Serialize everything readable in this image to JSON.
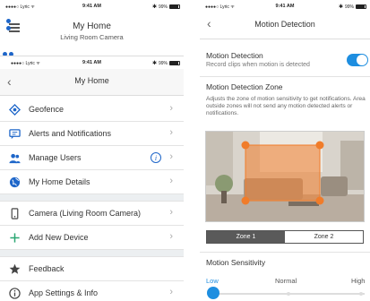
{
  "status_bar": {
    "carrier": "●●●●○ Lyric ᯤ",
    "time": "9:41 AM",
    "bluetooth": "✱",
    "battery": "99%"
  },
  "back_screen": {
    "title": "My Home",
    "subtitle": "Living Room Camera"
  },
  "front_screen": {
    "nav_title": "My Home",
    "items": [
      {
        "label": "Geofence",
        "icon": "geofence-icon"
      },
      {
        "label": "Alerts and Notifications",
        "icon": "chat-icon"
      },
      {
        "label": "Manage Users",
        "icon": "users-icon",
        "badge": "i"
      },
      {
        "label": "My Home Details",
        "icon": "globe-icon"
      },
      {
        "label": "Camera (Living Room Camera)",
        "icon": "phone-icon"
      },
      {
        "label": "Add New Device",
        "icon": "plus-icon"
      },
      {
        "label": "Feedback",
        "icon": "star-icon"
      },
      {
        "label": "App Settings & Info",
        "icon": "info-icon"
      }
    ]
  },
  "right_screen": {
    "status_battery": "99%",
    "nav_title": "Motion Detection",
    "motion_detection_title": "Motion Detection",
    "motion_detection_sub": "Record clips when motion is detected",
    "motion_detection_enabled": true,
    "zone_title": "Motion Detection Zone",
    "zone_desc": "Adjusts the zone of motion sensitivity to get notifications. Area outside zones will not send any motion detected alerts or notifications.",
    "zones": [
      "Zone 1",
      "Zone 2"
    ],
    "active_zone": "Zone 1",
    "sensitivity_title": "Motion Sensitivity",
    "sensitivity_levels": [
      "Low",
      "Normal",
      "High"
    ],
    "sensitivity_value": "Low"
  },
  "colors": {
    "accent": "#1e8ee0",
    "link_blue": "#1e66c9",
    "zone_orange": "#f07c2a"
  }
}
